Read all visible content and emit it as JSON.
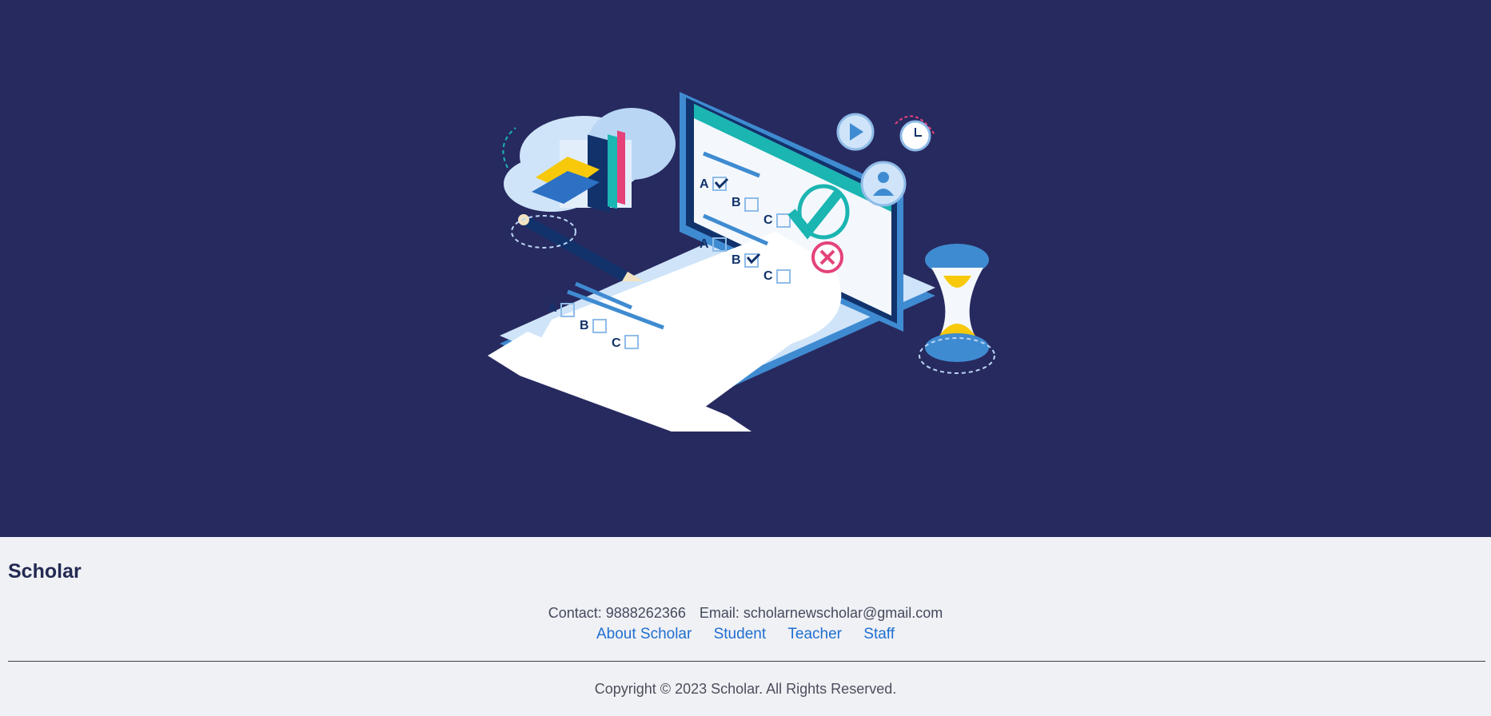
{
  "hero": {
    "illustration_icon": "online-exam-illustration",
    "illustration_letters": [
      "A",
      "B",
      "C",
      "A",
      "B",
      "C",
      "A",
      "B",
      "C"
    ]
  },
  "footer": {
    "brand": "Scholar",
    "contact": "Contact: 9888262366",
    "email": "Email: scholarnewscholar@gmail.com",
    "links": [
      "About Scholar",
      "Student",
      "Teacher",
      "Staff"
    ],
    "copyright": "Copyright © 2023 Scholar. All Rights Reserved."
  },
  "colors": {
    "hero_bg": "#272a5f",
    "footer_bg": "#f0f1f5",
    "link": "#1f6fd1",
    "teal": "#1bb5b2",
    "yellow": "#f7c90a",
    "pink": "#e5427a"
  }
}
